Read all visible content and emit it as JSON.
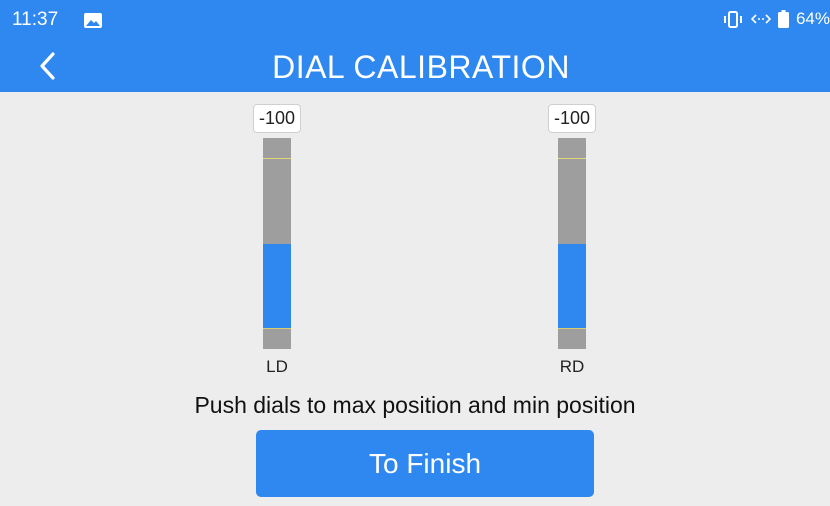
{
  "status_bar": {
    "time": "11:37",
    "battery_percent": "64%",
    "icons": [
      "image-icon",
      "vibrate-icon",
      "data-transfer-icon",
      "battery-icon"
    ]
  },
  "header": {
    "title": "DIAL CALIBRATION",
    "back_icon": "chevron-left-icon"
  },
  "dials": [
    {
      "label": "LD",
      "value": "-100",
      "fill_start_fraction": 0.5,
      "fill_end_fraction": 0.9
    },
    {
      "label": "RD",
      "value": "-100",
      "fill_start_fraction": 0.5,
      "fill_end_fraction": 0.9
    }
  ],
  "instruction": "Push dials to max position and min position",
  "finish_button": {
    "label": "To Finish"
  },
  "colors": {
    "accent": "#2f88f0",
    "track": "#9e9e9e",
    "background": "#ededed",
    "marker_line": "#e1d77a"
  }
}
